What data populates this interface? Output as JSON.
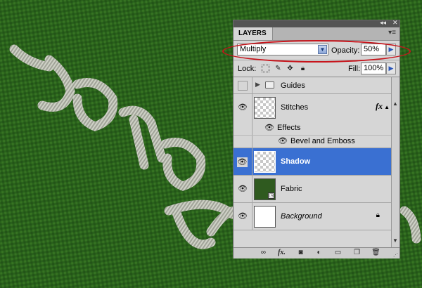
{
  "panel": {
    "tab_title": "LAYERS",
    "blend_mode": "Multiply",
    "opacity_label": "Opacity:",
    "opacity_value": "50%",
    "lock_label": "Lock:",
    "fill_label": "Fill:",
    "fill_value": "100%"
  },
  "layers": {
    "guides": "Guides",
    "stitches": "Stitches",
    "effects": "Effects",
    "bevel": "Bevel and Emboss",
    "shadow": "Shadow",
    "fabric": "Fabric",
    "background": "Background"
  },
  "colors": {
    "selection": "#3a70d2",
    "highlight_oval": "#c8141b",
    "fabric_green": "#2f6a1e"
  },
  "icons": {
    "eye": "eye-icon",
    "lock": "lock-icon",
    "folder": "folder-icon",
    "fx": "fx-icon"
  }
}
